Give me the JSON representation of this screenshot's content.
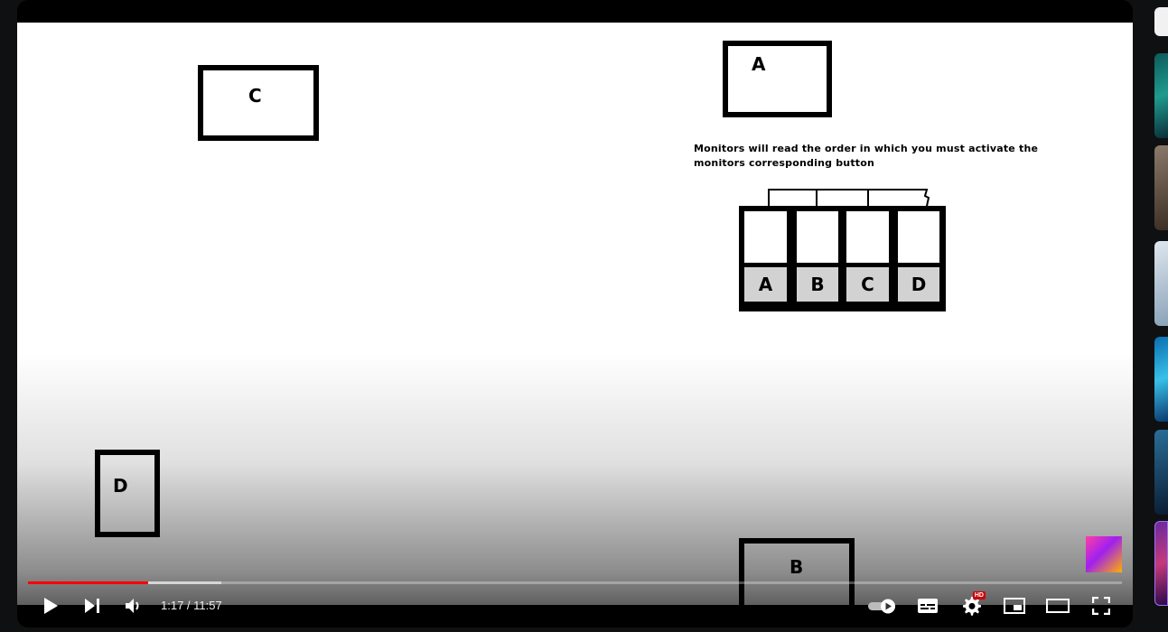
{
  "video": {
    "monitors": [
      {
        "id": "A",
        "label": "A"
      },
      {
        "id": "B",
        "label": "B"
      },
      {
        "id": "C",
        "label": "C"
      },
      {
        "id": "D",
        "label": "D"
      }
    ],
    "instruction": "Monitors will read the order in which you must activate the monitors corresponding button",
    "panel_buttons": [
      "A",
      "B",
      "C",
      "D"
    ]
  },
  "player": {
    "progress": {
      "played_fraction": 0.11,
      "buffered_fraction": 0.177
    },
    "time_current": "1:17",
    "time_separator": " / ",
    "time_total": "11:57",
    "hd_badge": "HD",
    "colors": {
      "progress": "#ff0000",
      "hd_badge": "#cc0000"
    },
    "icons": [
      "play-icon",
      "next-icon",
      "volume-icon",
      "autoplay-toggle-icon",
      "subtitles-icon",
      "settings-icon",
      "miniplayer-icon",
      "theater-icon",
      "fullscreen-icon"
    ]
  }
}
